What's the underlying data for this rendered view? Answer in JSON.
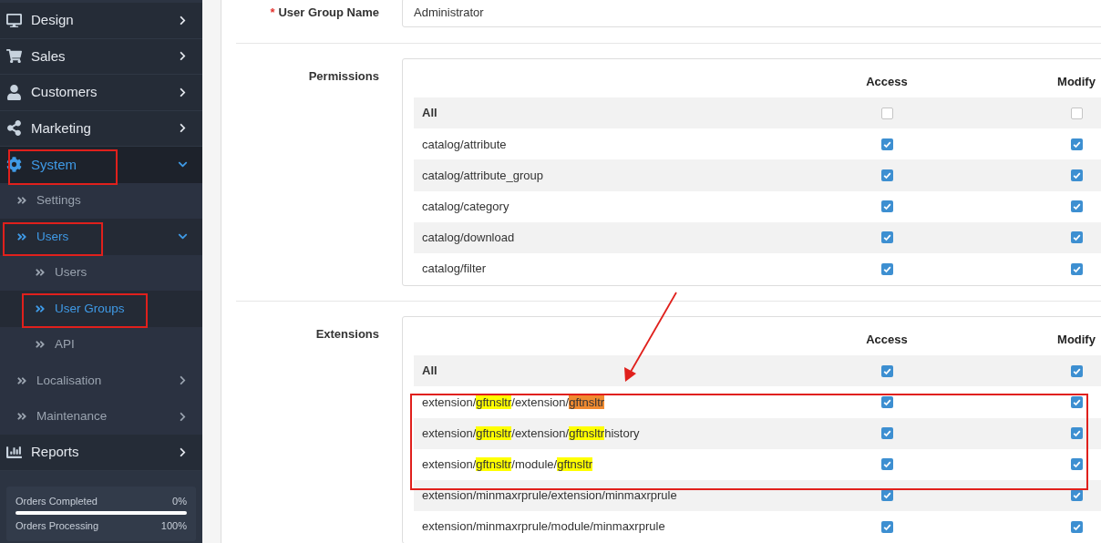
{
  "sidebar": {
    "items": [
      {
        "label": "Design",
        "selected": false,
        "expandable": true,
        "expanded": false
      },
      {
        "label": "Sales",
        "selected": false,
        "expandable": true,
        "expanded": false
      },
      {
        "label": "Customers",
        "selected": false,
        "expandable": true,
        "expanded": false
      },
      {
        "label": "Marketing",
        "selected": false,
        "expandable": true,
        "expanded": false
      },
      {
        "label": "System",
        "selected": true,
        "expandable": true,
        "expanded": true,
        "children": [
          {
            "label": "Settings",
            "selected": false,
            "expandable": false,
            "expanded": false
          },
          {
            "label": "Users",
            "selected": true,
            "expandable": true,
            "expanded": true,
            "children": [
              {
                "label": "Users",
                "selected": false,
                "expandable": false,
                "expanded": false
              },
              {
                "label": "User Groups",
                "selected": true,
                "expandable": false,
                "expanded": false
              },
              {
                "label": "API",
                "selected": false,
                "expandable": false,
                "expanded": false
              }
            ]
          },
          {
            "label": "Localisation",
            "selected": false,
            "expandable": true,
            "expanded": false
          },
          {
            "label": "Maintenance",
            "selected": false,
            "expandable": true,
            "expanded": false
          }
        ]
      },
      {
        "label": "Reports",
        "selected": false,
        "expandable": true,
        "expanded": false
      }
    ],
    "stats": [
      {
        "label": "Orders Completed",
        "value": "0%",
        "level": 0
      },
      {
        "label": "Orders Processing",
        "value": "100%"
      }
    ]
  },
  "form": {
    "name_field": {
      "label": "User Group Name",
      "required_mark": "*",
      "value": "Administrator"
    },
    "sections": [
      {
        "label": "Permissions",
        "columns": [
          "Access",
          "Modify"
        ],
        "rows": [
          {
            "segments": [
              {
                "text": "All"
              }
            ],
            "bold": true,
            "access": false,
            "modify": false
          },
          {
            "segments": [
              {
                "text": "catalog/attribute"
              }
            ],
            "bold": false,
            "access": true,
            "modify": true
          },
          {
            "segments": [
              {
                "text": "catalog/attribute_group"
              }
            ],
            "bold": false,
            "access": true,
            "modify": true
          },
          {
            "segments": [
              {
                "text": "catalog/category"
              }
            ],
            "bold": false,
            "access": true,
            "modify": true
          },
          {
            "segments": [
              {
                "text": "catalog/download"
              }
            ],
            "bold": false,
            "access": true,
            "modify": true
          },
          {
            "segments": [
              {
                "text": "catalog/filter"
              }
            ],
            "bold": false,
            "access": true,
            "modify": true
          }
        ]
      },
      {
        "label": "Extensions",
        "columns": [
          "Access",
          "Modify"
        ],
        "rows": [
          {
            "segments": [
              {
                "text": "All"
              }
            ],
            "bold": true,
            "access": true,
            "modify": true
          },
          {
            "segments": [
              {
                "text": "extension/"
              },
              {
                "text": "gftnsltr",
                "color": "#ffff00"
              },
              {
                "text": "/extension/"
              },
              {
                "text": "gftnsltr",
                "color": "#f08a30"
              }
            ],
            "bold": false,
            "access": true,
            "modify": true
          },
          {
            "segments": [
              {
                "text": "extension/"
              },
              {
                "text": "gftnsltr",
                "color": "#ffff00"
              },
              {
                "text": "/extension/"
              },
              {
                "text": "gftnsltr",
                "color": "#ffff00"
              },
              {
                "text": "history"
              }
            ],
            "bold": false,
            "access": true,
            "modify": true
          },
          {
            "segments": [
              {
                "text": "extension/"
              },
              {
                "text": "gftnsltr",
                "color": "#ffff00"
              },
              {
                "text": "/module/"
              },
              {
                "text": "gftnsltr",
                "color": "#ffff00"
              }
            ],
            "bold": false,
            "access": true,
            "modify": true
          },
          {
            "segments": [
              {
                "text": "extension/minmaxrprule/extension/minmaxrprule"
              }
            ],
            "bold": false,
            "access": true,
            "modify": true
          },
          {
            "segments": [
              {
                "text": "extension/minmaxrprule/module/minmaxrprule"
              }
            ],
            "bold": false,
            "access": true,
            "modify": true
          }
        ]
      }
    ]
  }
}
